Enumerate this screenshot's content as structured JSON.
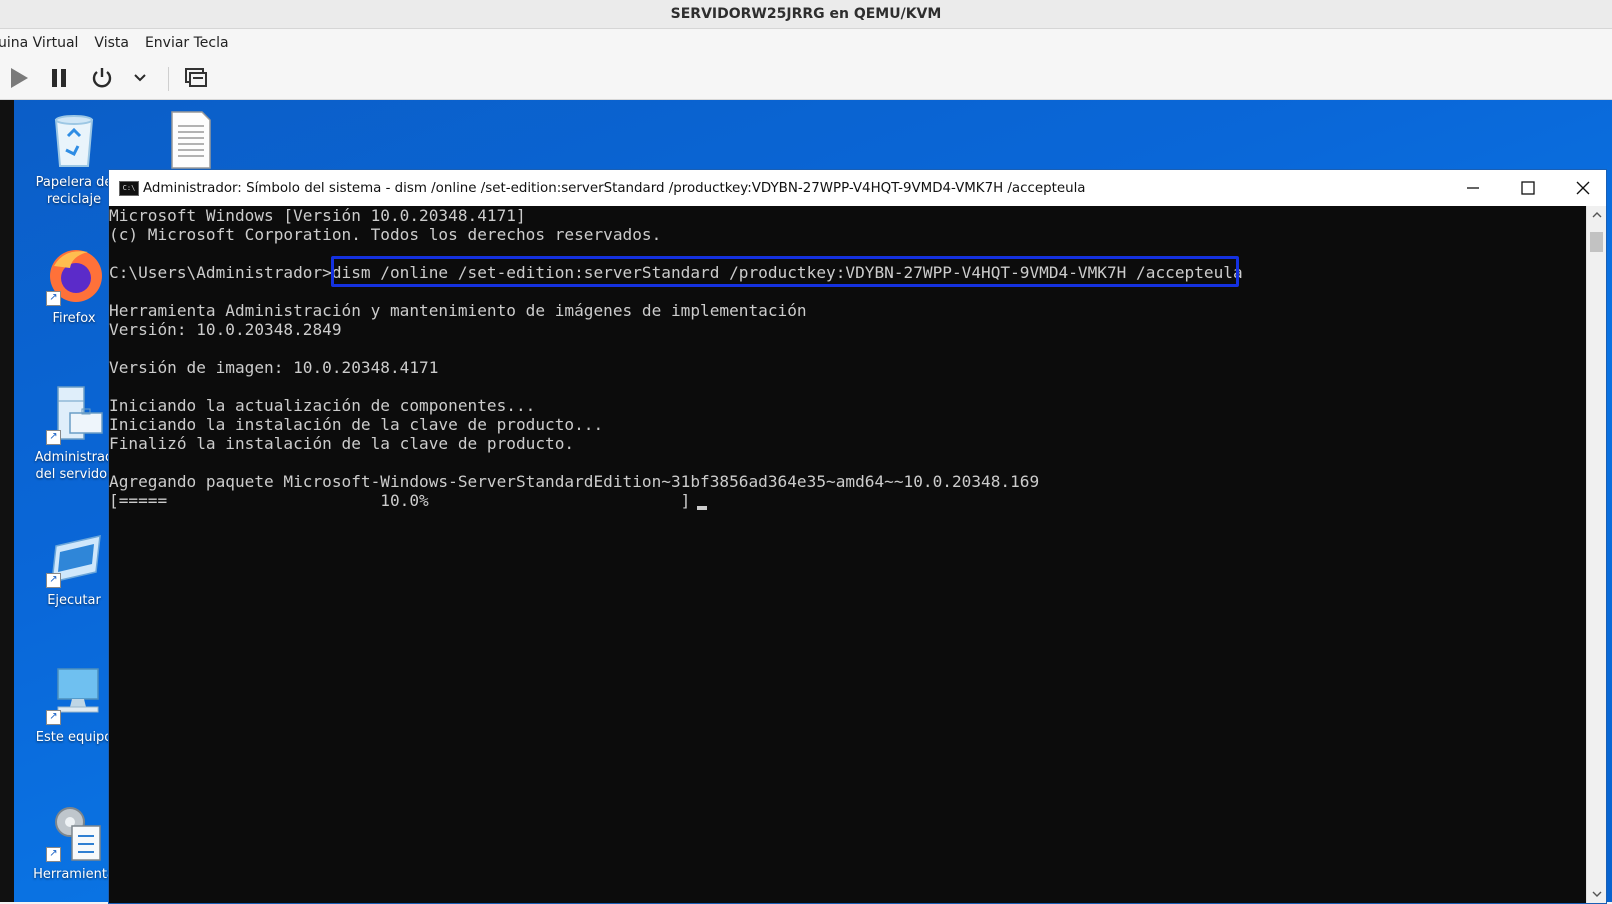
{
  "host": {
    "title": "SERVIDORW25JRRG en QEMU/KVM",
    "menu": [
      "uina Virtual",
      "Vista",
      "Enviar Tecla"
    ],
    "toolbar": [
      "play-icon",
      "pause-icon",
      "power-icon",
      "chevron-down-icon",
      "console-icon"
    ]
  },
  "desktop": {
    "icons": [
      {
        "label": "Papelera de reciclaje",
        "icon": "recycle-bin-icon"
      },
      {
        "label": "",
        "icon": "text-document-icon"
      },
      {
        "label": "Firefox",
        "icon": "firefox-icon"
      },
      {
        "label": "Administrad del servidor",
        "icon": "server-manager-icon"
      },
      {
        "label": "Ejecutar",
        "icon": "run-icon"
      },
      {
        "label": "Este equipo",
        "icon": "this-pc-icon"
      },
      {
        "label": "Herramienta",
        "icon": "tools-icon"
      }
    ]
  },
  "cmd": {
    "title": "Administrador: Símbolo del sistema - dism  /online /set-edition:serverStandard /productkey:VDYBN-27WPP-V4HQT-9VMD4-VMK7H /accepteula",
    "lines": [
      "Microsoft Windows [Versión 10.0.20348.4171]",
      "(c) Microsoft Corporation. Todos los derechos reservados.",
      "",
      "C:\\Users\\Administrador>dism /online /set-edition:serverStandard /productkey:VDYBN-27WPP-V4HQT-9VMD4-VMK7H /accepteula",
      "",
      "Herramienta Administración y mantenimiento de imágenes de implementación",
      "Versión: 10.0.20348.2849",
      "",
      "Versión de imagen: 10.0.20348.4171",
      "",
      "Iniciando la actualización de componentes...",
      "Iniciando la instalación de la clave de producto...",
      "Finalizó la instalación de la clave de producto.",
      "",
      "Agregando paquete Microsoft-Windows-ServerStandardEdition~31bf3856ad364e35~amd64~~10.0.20348.169",
      "[=====                      10.0%                          ] "
    ],
    "progress": 0.1
  },
  "colors": {
    "console_bg": "#0c0c0c",
    "console_fg": "#cccccc",
    "highlight": "#1431e0",
    "desktop": "#0a67d8"
  }
}
